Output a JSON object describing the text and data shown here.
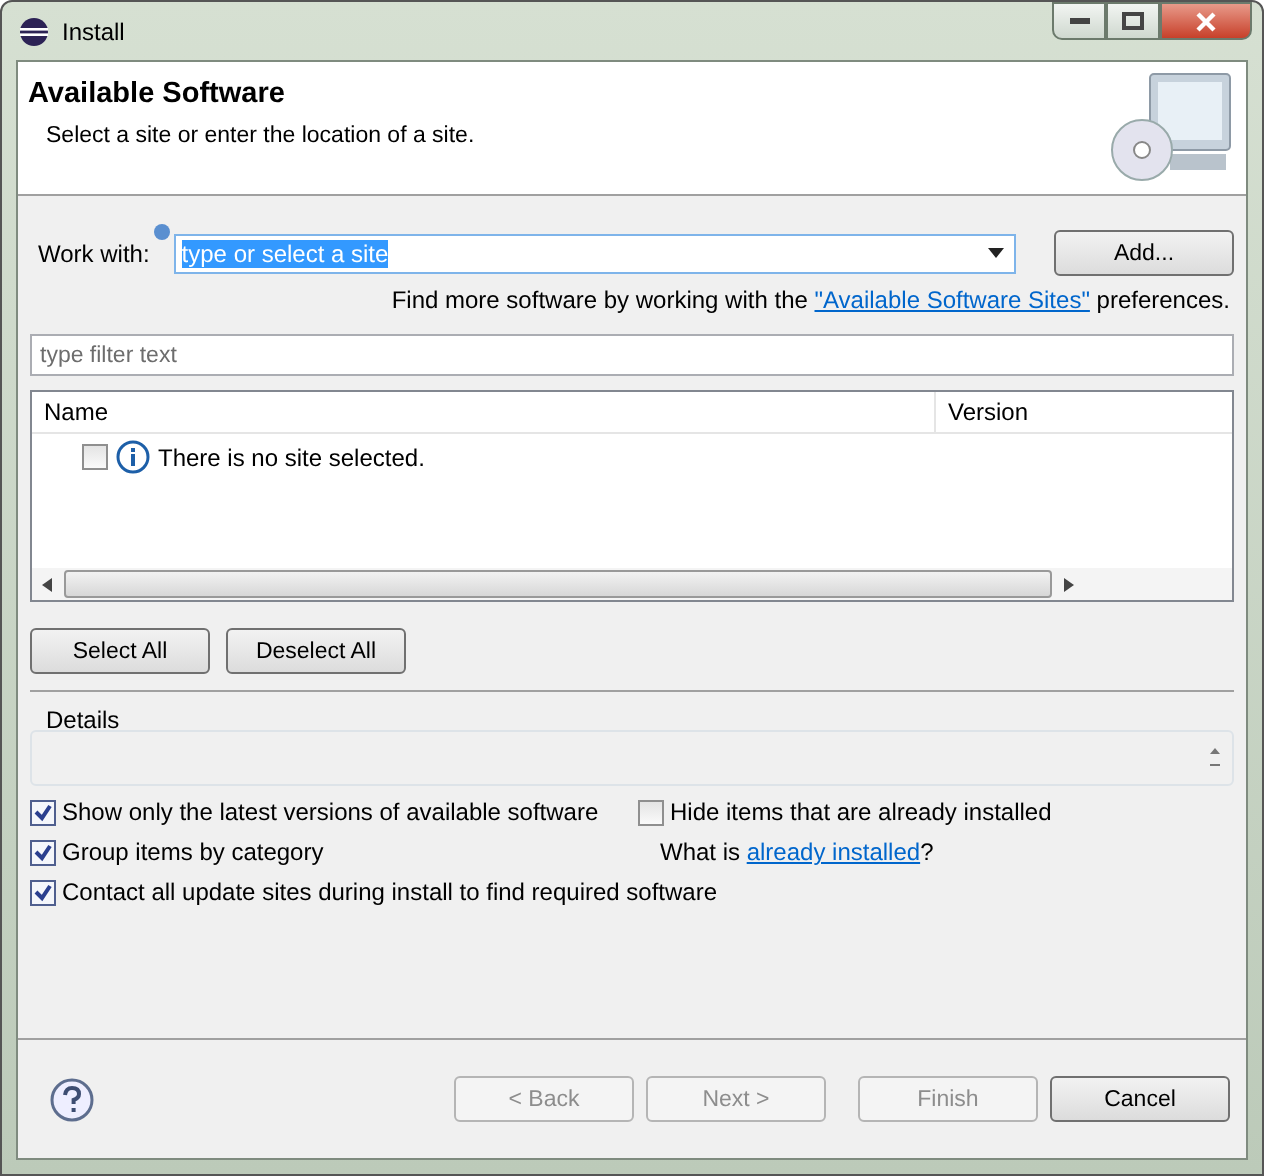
{
  "window": {
    "title": "Install"
  },
  "banner": {
    "title": "Available Software",
    "subtitle": "Select a site or enter the location of a site."
  },
  "work_with": {
    "label": "Work with:",
    "value": "type or select a site",
    "add_button": "Add..."
  },
  "hint": {
    "before": "Find more software by working with the ",
    "link": "\"Available Software Sites\"",
    "after": " preferences."
  },
  "filter": {
    "placeholder": "type filter text"
  },
  "table": {
    "columns": [
      "Name",
      "Version"
    ],
    "rows": [
      {
        "name": "There is no site selected.",
        "checked": false
      }
    ]
  },
  "selection_buttons": [
    "Select All",
    "Deselect All"
  ],
  "details": {
    "label": "Details"
  },
  "options": [
    {
      "label": "Show only the latest versions of available software",
      "checked": true
    },
    {
      "label": "Hide items that are already installed",
      "checked": false
    },
    {
      "label": "Group items by category",
      "checked": true
    },
    {
      "label": "Contact all update sites during install to find required software",
      "checked": true
    }
  ],
  "installed_hint": {
    "before": "What is ",
    "link": "already installed",
    "after": "?"
  },
  "footer_buttons": [
    {
      "label": "< Back",
      "disabled": true
    },
    {
      "label": "Next >",
      "disabled": true
    },
    {
      "label": "Finish",
      "disabled": true
    },
    {
      "label": "Cancel",
      "disabled": false
    }
  ]
}
